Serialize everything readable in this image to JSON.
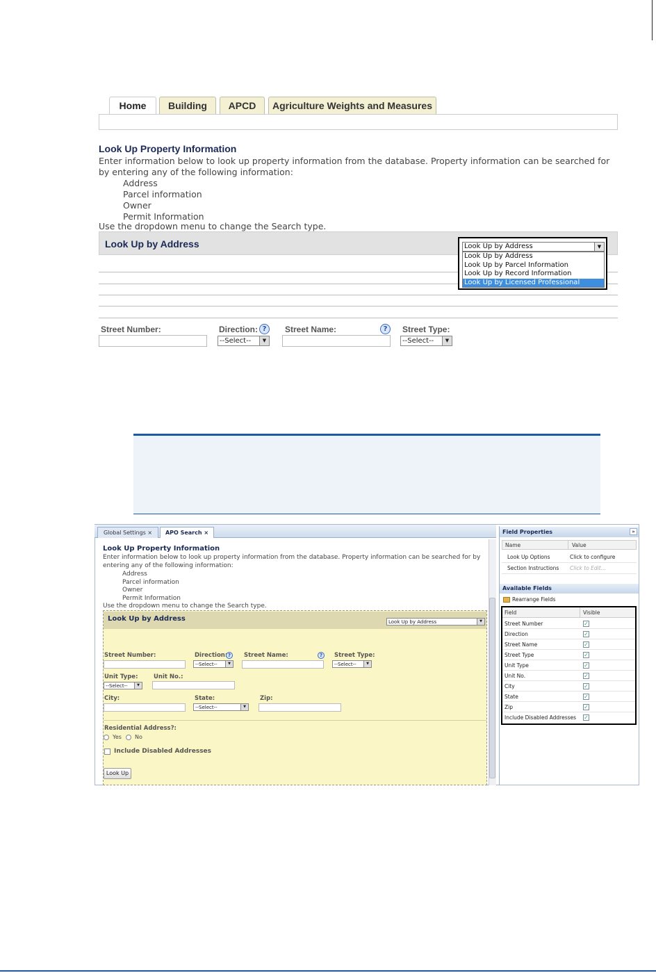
{
  "top": {
    "tabs": [
      "Home",
      "Building",
      "APCD",
      "Agriculture Weights and Measures"
    ],
    "title": "Look Up Property Information",
    "description": "Enter information below to look up property information from the database. Property information can be searched for by entering any of the following information:",
    "list": [
      "Address",
      "Parcel information",
      "Owner",
      "Permit Information"
    ],
    "hint": "Use the dropdown menu to change the Search type.",
    "section_title": "Look Up by Address",
    "dropdown": {
      "selected": "Look Up by Address",
      "options": [
        "Look Up by Address",
        "Look Up by Parcel Information",
        "Look Up by Record Information",
        "Look Up by Licensed Professional"
      ]
    },
    "fields": {
      "street_number": "Street Number:",
      "direction": "Direction:",
      "street_name": "Street Name:",
      "street_type": "Street Type:",
      "select_placeholder": "--Select--",
      "help": "?"
    }
  },
  "bottom": {
    "tabs": [
      "Global Settings",
      "APO Search"
    ],
    "close_glyph": "×",
    "title": "Look Up Property Information",
    "description": "Enter information below to look up property information from the database. Property information can be searched for by entering any of the following information:",
    "list": [
      "Address",
      "Parcel information",
      "Owner",
      "Permit Information"
    ],
    "hint": "Use the dropdown menu to change the Search type.",
    "section_title": "Look Up by Address",
    "section_select": "Look Up by Address",
    "fields": {
      "street_number": "Street Number:",
      "direction": "Direction:",
      "street_name": "Street Name:",
      "street_type": "Street Type:",
      "unit_type": "Unit Type:",
      "unit_no": "Unit No.:",
      "city": "City:",
      "state": "State:",
      "zip": "Zip:",
      "select_placeholder": "--Select--",
      "help": "?"
    },
    "residential": "Residential Address?:",
    "yes": "Yes",
    "no": "No",
    "include_disabled": "Include Disabled Addresses",
    "lookup_button": "Look Up",
    "panel": {
      "title": "Field Properties",
      "collapse": "»",
      "col_name": "Name",
      "col_value": "Value",
      "rows": [
        {
          "name": "Look Up Options",
          "value": "Click to configure"
        },
        {
          "name": "Section Instructions",
          "value": "Click to Edit..."
        }
      ],
      "available_title": "Available Fields",
      "rearrange": "Rearrange Fields",
      "col_field": "Field",
      "col_visible": "Visible",
      "check_glyph": "✓",
      "fields": [
        "Street Number",
        "Direction",
        "Street Name",
        "Street Type",
        "Unit Type",
        "Unit No.",
        "City",
        "State",
        "Zip",
        "Include Disabled Addresses"
      ]
    }
  },
  "colors": {
    "accent": "#1f5aa0",
    "title": "#1a2a55",
    "yellow": "#fbf6c6",
    "selected": "#3e8ee0"
  }
}
